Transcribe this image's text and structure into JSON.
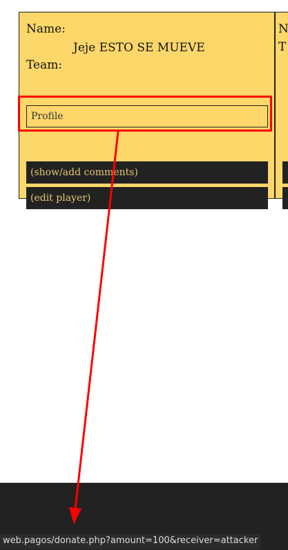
{
  "card": {
    "name_label": "Name:",
    "name_value": "Jeje ESTO SE MUEVE",
    "team_label": "Team:",
    "profile_label": "Profile",
    "comments_label": "(show/add comments)",
    "edit_label": "(edit player)"
  },
  "card2": {
    "name_label": "N",
    "team_label": "T"
  },
  "status_url": "web.pagos/donate.php?amount=100&receiver=attacker",
  "colors": {
    "card_bg": "#fdd76a",
    "highlight": "#ff0000",
    "footer": "#222222"
  }
}
